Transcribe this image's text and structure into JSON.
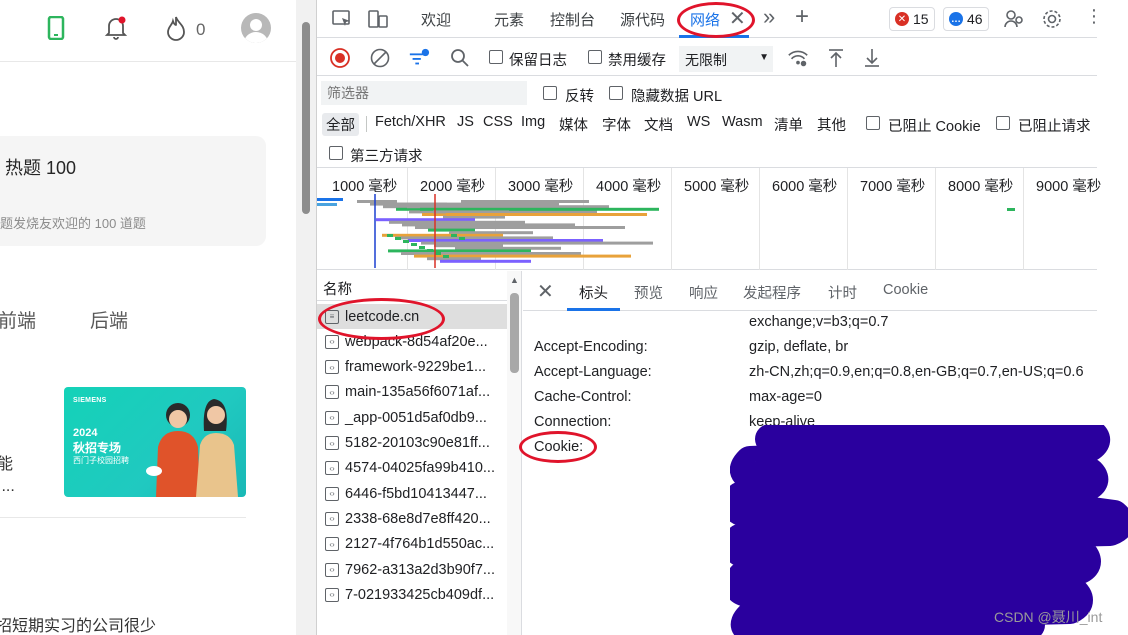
{
  "site": {
    "notif_count": "0",
    "card_title": "热题 100",
    "card_sub": "题发烧友欢迎的 100 道题",
    "tabs": [
      "前端",
      "后端"
    ],
    "banner": {
      "brand": "SIEMENS",
      "year": "2024",
      "title": "秋招专场",
      "sub": "西门子校园招聘"
    },
    "side_text1": "能",
    "side_text2": "I...",
    "bottom_text": "招短期实习的公司很少"
  },
  "devtools": {
    "tabs": [
      "欢迎",
      "元素",
      "控制台",
      "源代码",
      "网络"
    ],
    "errors": "15",
    "messages": "46",
    "toolbar": {
      "preserve_log": "保留日志",
      "disable_cache": "禁用缓存",
      "throttle": "无限制"
    },
    "filter": {
      "placeholder": "筛选器",
      "invert": "反转",
      "hide_data_urls": "隐藏数据 URL"
    },
    "types": [
      "全部",
      "Fetch/XHR",
      "JS",
      "CSS",
      "Img",
      "媒体",
      "字体",
      "文档",
      "WS",
      "Wasm",
      "清单",
      "其他"
    ],
    "blocked_cookies": "已阻止 Cookie",
    "blocked_requests": "已阻止请求",
    "third_party": "第三方请求",
    "ticks": [
      "1000 毫秒",
      "2000 毫秒",
      "3000 毫秒",
      "4000 毫秒",
      "5000 毫秒",
      "6000 毫秒",
      "7000 毫秒",
      "8000 毫秒",
      "9000 毫秒"
    ],
    "list_header": "名称",
    "requests": [
      "leetcode.cn",
      "webpack-8d54af20e...",
      "framework-9229be1...",
      "main-135a56f6071af...",
      "_app-0051d5af0db9...",
      "5182-20103c90e81ff...",
      "4574-04025fa99b410...",
      "6446-f5bd10413447...",
      "2338-68e8d7e8ff420...",
      "2127-4f764b1d550ac...",
      "7962-a313a2d3b90f7...",
      "7-021933425cb409df..."
    ],
    "detail_tabs": [
      "标头",
      "预览",
      "响应",
      "发起程序",
      "计时",
      "Cookie"
    ],
    "headers": {
      "partial": "exchange;v=b3;q=0.7",
      "rows": [
        {
          "k": "Accept-Encoding:",
          "v": "gzip, deflate, br"
        },
        {
          "k": "Accept-Language:",
          "v": "zh-CN,zh;q=0.9,en;q=0.8,en-GB;q=0.7,en-US;q=0.6"
        },
        {
          "k": "Cache-Control:",
          "v": "max-age=0"
        },
        {
          "k": "Connection:",
          "v": "keep-alive"
        },
        {
          "k": "Cookie:",
          "v": ""
        }
      ]
    }
  },
  "watermark": "CSDN @聂川_int"
}
